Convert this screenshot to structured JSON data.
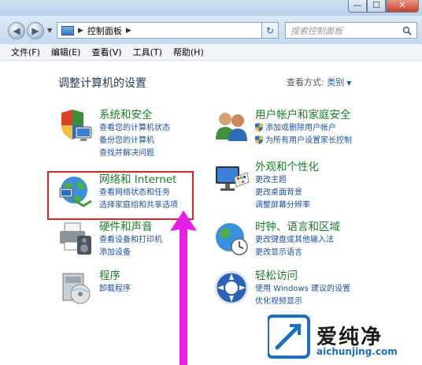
{
  "window": {
    "minimize_glyph": "—",
    "maximize_glyph": "☐",
    "close_glyph": "✕"
  },
  "nav": {
    "back_glyph": "◀",
    "forward_glyph": "▶",
    "breadcrumb": "控制面板",
    "refresh_glyph": "↻",
    "search_placeholder": "搜索控制面板"
  },
  "menu": [
    "文件(F)",
    "编辑(E)",
    "查看(V)",
    "工具(T)",
    "帮助(H)"
  ],
  "content": {
    "title": "调整计算机的设置",
    "view_by_label": "查看方式:",
    "view_by_value": "类别"
  },
  "categories": [
    {
      "id": "system-security",
      "title": "系统和安全",
      "icon": "shield-pc-icon",
      "links": [
        "查看您的计算机状态",
        "备份您的计算机",
        "查找并解决问题"
      ]
    },
    {
      "id": "user-accounts",
      "title": "用户帐户和家庭安全",
      "icon": "users-icon",
      "links": [
        "添加或删除用户帐户",
        "为所有用户设置家长控制"
      ]
    },
    {
      "id": "network-internet",
      "title": "网络和 Internet",
      "icon": "globe-network-icon",
      "links": [
        "查看网络状态和任务",
        "选择家庭组和共享选项"
      ]
    },
    {
      "id": "appearance",
      "title": "外观和个性化",
      "icon": "monitor-palette-icon",
      "links": [
        "更改主题",
        "更改桌面背景",
        "调整屏幕分辨率"
      ]
    },
    {
      "id": "hardware-sound",
      "title": "硬件和声音",
      "icon": "printer-speaker-icon",
      "links": [
        "查看设备和打印机",
        "添加设备"
      ]
    },
    {
      "id": "clock-region",
      "title": "时钟、语言和区域",
      "icon": "clock-globe-icon",
      "links": [
        "更改键盘或其他输入法",
        "更改显示语言"
      ]
    },
    {
      "id": "programs",
      "title": "程序",
      "icon": "programs-icon",
      "links": [
        "卸载程序"
      ]
    },
    {
      "id": "ease-of-access",
      "title": "轻松访问",
      "icon": "accessibility-icon",
      "links": [
        "使用 Windows 建议的设置",
        "优化视频显示"
      ]
    }
  ],
  "watermark": {
    "brand": "爱纯净",
    "url": "aichunjing.com"
  },
  "colors": {
    "category_title": "#1e7b29",
    "link": "#1a4f9e",
    "highlight_box": "#e02424",
    "arrow": "#e61ee6"
  }
}
